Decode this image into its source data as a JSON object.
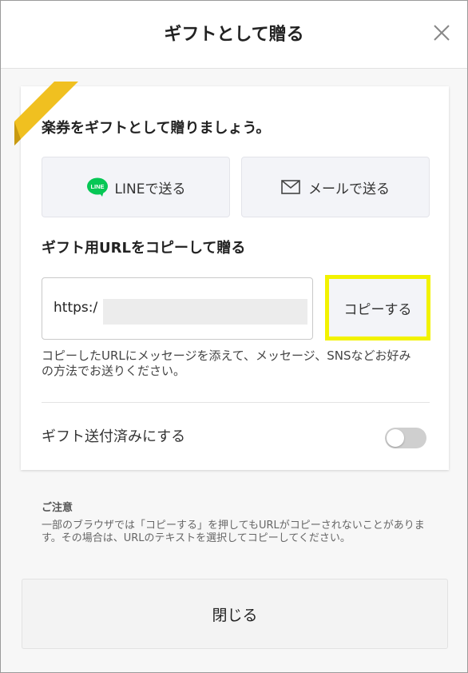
{
  "header": {
    "title": "ギフトとして贈る",
    "close_icon": "close-icon"
  },
  "card": {
    "title": "楽券をギフトとして贈りましょう。",
    "line_button_label": "LINEで送る",
    "mail_button_label": "メールで送る",
    "url_heading": "ギフト用URLをコピーして贈る",
    "url_value": "https:/",
    "copy_button_label": "コピーする",
    "helper_text": "コピーしたURLにメッセージを添えて、メッセージ、SNSなどお好みの方法でお送りください。",
    "toggle_label": "ギフト送付済みにする",
    "toggle_on": false
  },
  "notice": {
    "title": "ご注意",
    "text": "一部のブラウザでは「コピーする」を押してもURLがコピーされないことがあります。その場合は、URLのテキストを選択してコピーしてください。"
  },
  "footer": {
    "close_label": "閉じる"
  },
  "colors": {
    "highlight": "#f2f200",
    "ribbon": "#f0c020",
    "line_green": "#06c755",
    "toggle_off": "#cfcfcf"
  }
}
